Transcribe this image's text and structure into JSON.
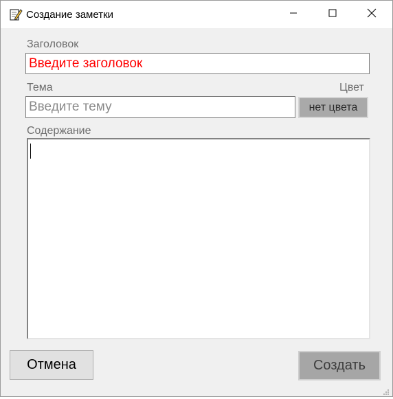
{
  "window": {
    "title": "Создание заметки",
    "icons": {
      "app": "notepad-pencil-icon",
      "minimize": "minimize-icon",
      "maximize": "maximize-icon",
      "close": "close-icon"
    }
  },
  "form": {
    "title_label": "Заголовок",
    "title_value": "Введите заголовок",
    "title_value_color": "#ff0000",
    "topic_label": "Тема",
    "topic_placeholder": "Введите тему",
    "color_label": "Цвет",
    "color_button": "нет цвета",
    "content_label": "Содержание",
    "content_value": ""
  },
  "buttons": {
    "cancel": "Отмена",
    "create": "Создать"
  }
}
